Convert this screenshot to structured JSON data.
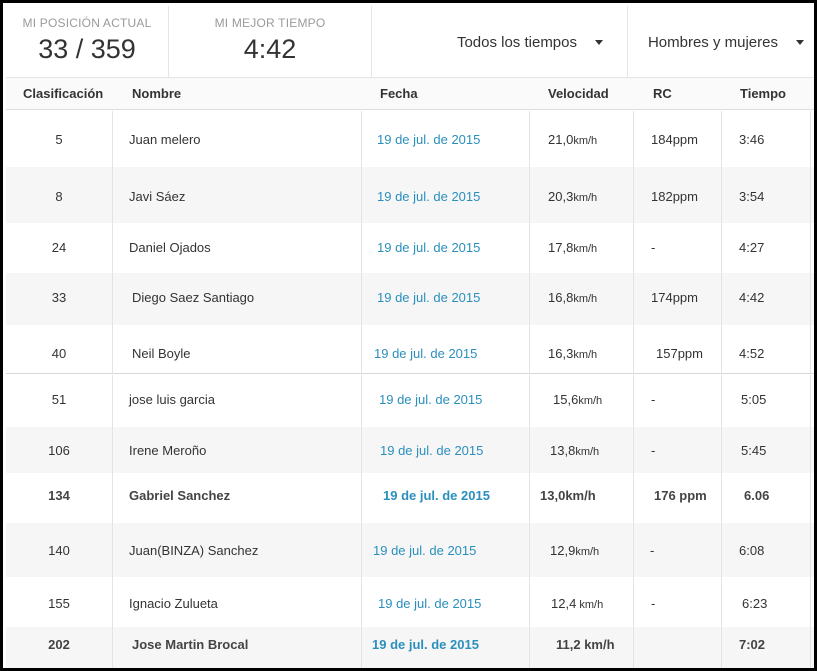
{
  "stats": {
    "position_label": "MI POSICIÓN ACTUAL",
    "position_value": "33 / 359",
    "best_label": "MI MEJOR TIEMPO",
    "best_value": "4:42"
  },
  "filters": {
    "time": "Todos los tiempos",
    "gender": "Hombres y mujeres"
  },
  "columns": {
    "rank": "Clasificación",
    "name": "Nombre",
    "date": "Fecha",
    "speed": "Velocidad",
    "hr": "RC",
    "time": "Tiempo"
  },
  "rows": [
    {
      "rank": "5",
      "name": "Juan melero",
      "date": "19 de jul. de 2015",
      "speed": "21,0",
      "speed_unit": "km/h",
      "hr": "184ppm",
      "time": "3:46"
    },
    {
      "rank": "8",
      "name": "Javi Sáez",
      "date": "19 de jul. de 2015",
      "speed": "20,3",
      "speed_unit": "km/h",
      "hr": "182ppm",
      "time": "3:54"
    },
    {
      "rank": "24",
      "name": "Daniel Ojados",
      "date": "19 de jul. de 2015",
      "speed": "17,8",
      "speed_unit": "km/h",
      "hr": "-",
      "time": "4:27"
    },
    {
      "rank": "33",
      "name": "Diego Saez Santiago",
      "date": "19 de jul. de 2015",
      "speed": "16,8",
      "speed_unit": "km/h",
      "hr": "174ppm",
      "time": "4:42"
    },
    {
      "rank": "40",
      "name": "Neil Boyle",
      "date": "19 de jul. de 2015",
      "speed": "16,3",
      "speed_unit": "km/h",
      "hr": "157ppm",
      "time": "4:52"
    },
    {
      "rank": "51",
      "name": "jose luis garcia",
      "date": "19 de jul. de 2015",
      "speed": "15,6",
      "speed_unit": "km/h",
      "hr": "-",
      "time": "5:05"
    },
    {
      "rank": "106",
      "name": "Irene Meroño",
      "date": "19 de jul. de 2015",
      "speed": "13,8",
      "speed_unit": "km/h",
      "hr": "-",
      "time": "5:45"
    },
    {
      "rank": "134",
      "name": "Gabriel Sanchez",
      "date": "19 de jul. de 2015",
      "speed": "13,0",
      "speed_unit": "km/h",
      "hr": "176 ppm",
      "time": "6.06"
    },
    {
      "rank": "140",
      "name": "Juan(BINZA) Sanchez",
      "date": "19 de jul. de 2015",
      "speed": "12,9",
      "speed_unit": "km/h",
      "hr": "-",
      "time": "6:08"
    },
    {
      "rank": "155",
      "name": "Ignacio Zulueta",
      "date": "19 de jul. de 2015",
      "speed": "12,4",
      "speed_unit": " km/h",
      "hr": "-",
      "time": "6:23"
    },
    {
      "rank": "202",
      "name": "Jose Martin Brocal",
      "date": "19 de jul. de 2015",
      "speed": "11,2",
      "speed_unit": " km/h",
      "hr": "",
      "time": "7:02"
    }
  ]
}
